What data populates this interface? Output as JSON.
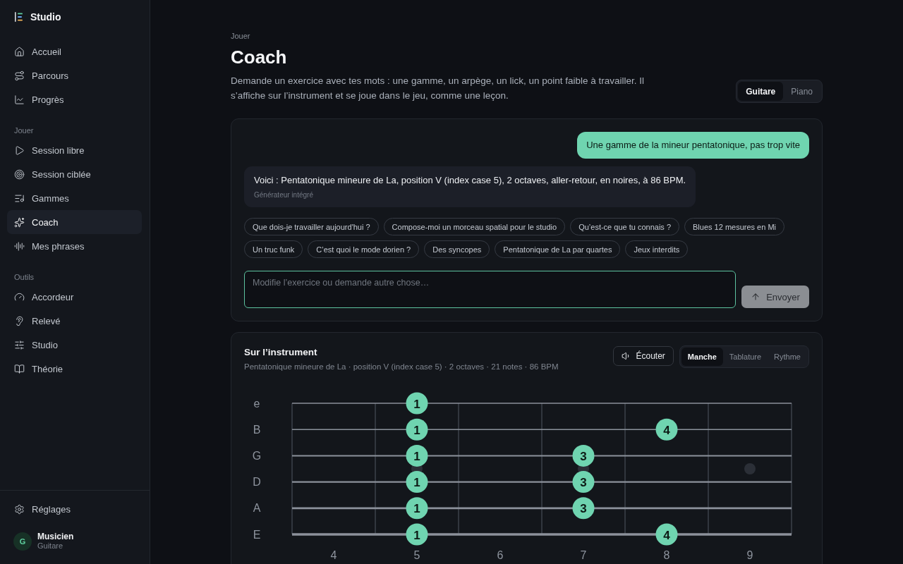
{
  "sidebar": {
    "brand": "Studio",
    "sections": [
      {
        "items": [
          {
            "label": "Accueil",
            "selected": false
          },
          {
            "label": "Parcours",
            "selected": false
          },
          {
            "label": "Progrès",
            "selected": false
          }
        ]
      },
      {
        "heading": "Jouer",
        "items": [
          {
            "label": "Session libre",
            "selected": false
          },
          {
            "label": "Session ciblée",
            "selected": false
          },
          {
            "label": "Gammes",
            "selected": false
          },
          {
            "label": "Coach",
            "selected": true
          },
          {
            "label": "Mes phrases",
            "selected": false
          }
        ]
      },
      {
        "heading": "Outils",
        "items": [
          {
            "label": "Accordeur",
            "selected": false
          },
          {
            "label": "Relevé",
            "selected": false
          },
          {
            "label": "Studio",
            "selected": false
          },
          {
            "label": "Théorie",
            "selected": false
          }
        ]
      }
    ],
    "settings": {
      "label": "Réglages",
      "selected": false
    },
    "user": {
      "initial": "G",
      "name": "Musicien",
      "role": "Guitare"
    }
  },
  "header": {
    "breadcrumb": "Jouer",
    "title": "Coach",
    "description": "Demande un exercice avec tes mots : une gamme, un arpège, un lick, un point faible à travailler. Il s’affiche sur l’instrument et se joue dans le jeu, comme une leçon.",
    "instrument_toggle": [
      {
        "label": "Guitare",
        "selected": true
      },
      {
        "label": "Piano",
        "selected": false
      }
    ]
  },
  "chat": {
    "messages": [
      {
        "kind": "user",
        "text": "Une gamme de la mineur pentatonique, pas trop vite"
      },
      {
        "kind": "assistant",
        "text": "Voici : Pentatonique mineure de La, position V (index case 5), 2 octaves, aller-retour, en noires, à 86 BPM.",
        "source": "Générateur intégré"
      }
    ],
    "suggestions": [
      "Que dois-je travailler aujourd'hui ?",
      "Compose-moi un morceau spatial pour le studio",
      "Qu’est-ce que tu connais ?",
      "Blues 12 mesures en Mi",
      "Un truc funk",
      "C’est quoi le mode dorien ?",
      "Des syncopes",
      "Pentatonique de La par quartes",
      "Jeux interdits"
    ],
    "input": {
      "placeholder": "Modifie l’exercice ou demande autre chose…",
      "focused": true
    },
    "send_button": {
      "label": "Envoyer",
      "disabled": true
    }
  },
  "instrument": {
    "title": "Sur l’instrument",
    "subtitle": "Pentatonique mineure de La · position V (index case 5) · 2 octaves · 21 notes · 86 BPM",
    "listen_button": "Écouter",
    "views": [
      {
        "label": "Manche",
        "selected": true
      },
      {
        "label": "Tablature",
        "selected": false
      },
      {
        "label": "Rythme",
        "selected": false
      }
    ],
    "fretboard": {
      "frets": [
        {
          "label": "4",
          "inlay": false
        },
        {
          "label": "5",
          "inlay": true
        },
        {
          "label": "6",
          "inlay": false
        },
        {
          "label": "7",
          "inlay": true
        },
        {
          "label": "8",
          "inlay": false
        },
        {
          "label": "9",
          "inlay": true
        }
      ],
      "strings": [
        {
          "label": "e",
          "positions": [
            {
              "kind": "empty"
            },
            {
              "kind": "note",
              "finger": "1"
            },
            {
              "kind": "empty"
            },
            {
              "kind": "empty"
            },
            {
              "kind": "empty"
            },
            {
              "kind": "empty"
            }
          ]
        },
        {
          "label": "B",
          "positions": [
            {
              "kind": "empty"
            },
            {
              "kind": "note",
              "finger": "1"
            },
            {
              "kind": "empty"
            },
            {
              "kind": "empty"
            },
            {
              "kind": "note",
              "finger": "4"
            },
            {
              "kind": "empty"
            }
          ]
        },
        {
          "label": "G",
          "positions": [
            {
              "kind": "empty"
            },
            {
              "kind": "note",
              "finger": "1"
            },
            {
              "kind": "empty"
            },
            {
              "kind": "note",
              "finger": "3"
            },
            {
              "kind": "empty"
            },
            {
              "kind": "empty"
            }
          ]
        },
        {
          "label": "D",
          "positions": [
            {
              "kind": "empty"
            },
            {
              "kind": "note",
              "finger": "1"
            },
            {
              "kind": "empty"
            },
            {
              "kind": "note",
              "finger": "3"
            },
            {
              "kind": "empty"
            },
            {
              "kind": "empty"
            }
          ]
        },
        {
          "label": "A",
          "positions": [
            {
              "kind": "empty"
            },
            {
              "kind": "note",
              "finger": "1"
            },
            {
              "kind": "empty"
            },
            {
              "kind": "note",
              "finger": "3"
            },
            {
              "kind": "empty"
            },
            {
              "kind": "empty"
            }
          ]
        },
        {
          "label": "E",
          "positions": [
            {
              "kind": "empty"
            },
            {
              "kind": "note",
              "finger": "1"
            },
            {
              "kind": "empty"
            },
            {
              "kind": "empty"
            },
            {
              "kind": "note",
              "finger": "4"
            },
            {
              "kind": "empty"
            }
          ]
        }
      ]
    }
  }
}
